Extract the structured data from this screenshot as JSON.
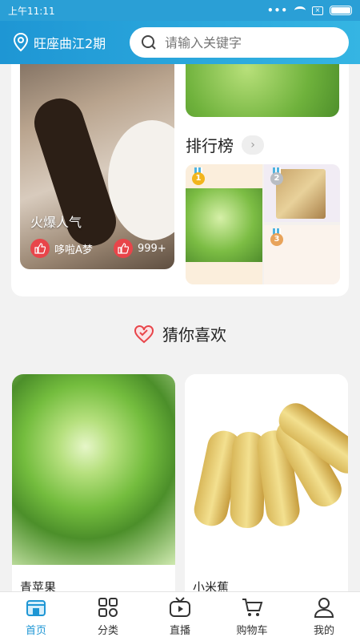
{
  "status_bar": {
    "time": "上午11:11",
    "dots": "•••",
    "sim": "×"
  },
  "header": {
    "location": "旺座曲江2期",
    "search_placeholder": "请输入关键字"
  },
  "hot": {
    "title": "火爆人气",
    "user": "哆啦A梦",
    "likes": "999+"
  },
  "ranking": {
    "title": "排行榜",
    "more": "›",
    "medals": [
      "1",
      "2",
      "3"
    ]
  },
  "guess": {
    "title": "猜你喜欢"
  },
  "products": [
    {
      "name": "青苹果"
    },
    {
      "name": "小米蕉"
    }
  ],
  "tabbar": {
    "items": [
      {
        "label": "首页",
        "icon": "home-store-icon",
        "active": true
      },
      {
        "label": "分类",
        "icon": "grid-icon"
      },
      {
        "label": "直播",
        "icon": "tv-play-icon"
      },
      {
        "label": "购物车",
        "icon": "cart-icon"
      },
      {
        "label": "我的",
        "icon": "user-icon"
      }
    ]
  },
  "colors": {
    "accent": "#1e96d4",
    "like_red": "#e8454a"
  }
}
